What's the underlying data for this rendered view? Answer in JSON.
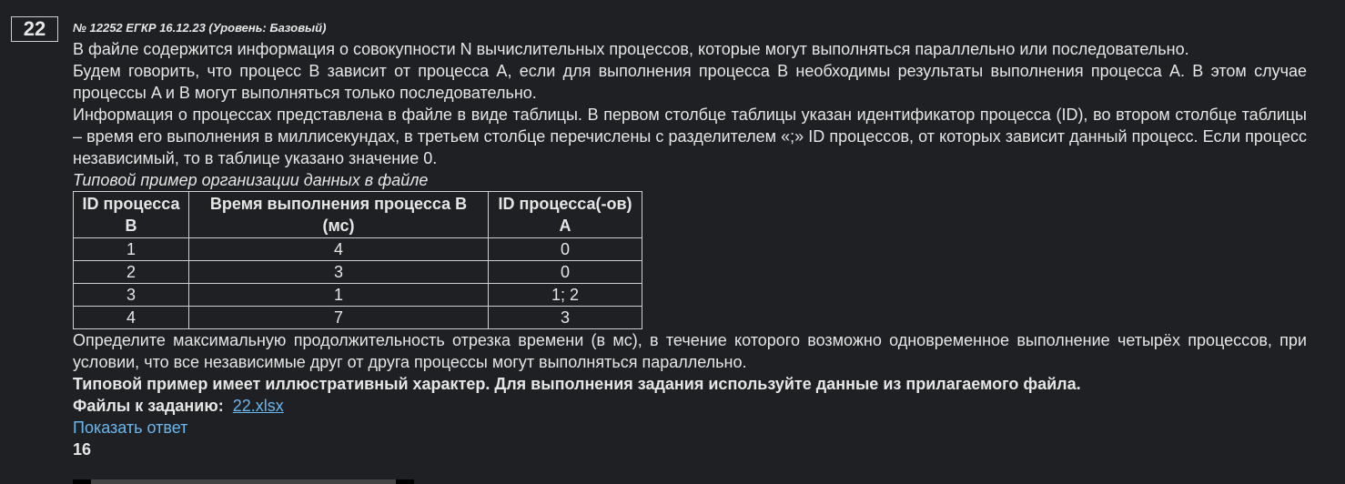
{
  "task_number": "22",
  "header": "№ 12252 ЕГКР 16.12.23 (Уровень: Базовый)",
  "paragraphs": [
    "В файле содержится информация о совокупности N вычислительных процессов, которые могут выполняться параллельно или последовательно.",
    "Будем говорить, что процесс B зависит от процесса A, если для выполнения процесса B необходимы результаты выполнения процесса A. В этом случае процессы A и B могут выполняться только последовательно.",
    "Информация о процессах представлена в файле в виде таблицы. В первом столбце таблицы указан идентификатор процесса (ID), во втором столбце таблицы – время его выполнения в миллисекундах, в третьем столбце перечислены с разделителем «;» ID процессов, от которых зависит данный процесс. Если процесс независимый, то в таблице указано значение 0."
  ],
  "example_caption": "Типовой пример организации данных в файле",
  "table": {
    "headers": [
      "ID процесса B",
      "Время выполнения процесса B (мс)",
      "ID процесса(-ов) A"
    ],
    "rows": [
      [
        "1",
        "4",
        "0"
      ],
      [
        "2",
        "3",
        "0"
      ],
      [
        "3",
        "1",
        "1; 2"
      ],
      [
        "4",
        "7",
        "3"
      ]
    ]
  },
  "question": "Определите максимальную продолжительность отрезка времени (в мс), в течение которого возможно одновременное выполнение четырёх процессов, при условии, что все независимые друг от друга процессы могут выполняться параллельно.",
  "note": "Типовой пример имеет иллюстративный характер. Для выполнения задания используйте данные из прилагаемого файла.",
  "files_label": "Файлы к заданию:",
  "file_link": "22.xlsx",
  "show_answer": "Показать ответ",
  "answer": "16"
}
